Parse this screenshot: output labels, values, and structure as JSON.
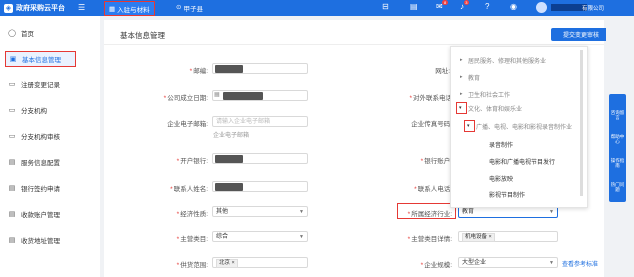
{
  "topbar": {
    "app_name": "政府采购云平台",
    "menu_icon": "hamburger-icon",
    "settle_label": "入驻与材料",
    "location_label": "甲子县",
    "badge_messages": "8",
    "badge_notice": "3",
    "user_suffix": "有限公司"
  },
  "sidebar": {
    "items": [
      {
        "label": "首页",
        "icon": "home-icon"
      },
      {
        "label": "基本信息管理",
        "icon": "info-card-icon"
      },
      {
        "label": "注册变更记录",
        "icon": "record-icon"
      },
      {
        "label": "分支机构",
        "icon": "branch-icon"
      },
      {
        "label": "分支机构审核",
        "icon": "audit-icon"
      },
      {
        "label": "服务信息配置",
        "icon": "service-icon"
      },
      {
        "label": "银行签约申请",
        "icon": "bank-icon"
      },
      {
        "label": "收款账户管理",
        "icon": "account-icon"
      },
      {
        "label": "收货地址管理",
        "icon": "address-icon"
      }
    ]
  },
  "main": {
    "title": "基本信息管理",
    "submit_label": "提交变更审核"
  },
  "form": {
    "postcode_label": "邮编:",
    "website_label": "网址:",
    "founded_label": "公司成立日期:",
    "external_phone_label": "对外联系电话",
    "email_label": "企业电子邮箱:",
    "email_placeholder": "请输入企业电子邮箱",
    "email_hint": "企业电子邮箱",
    "fax_label": "企业传真号码:",
    "bank_label": "开户银行:",
    "account_label": "银行账户:",
    "contact_name_label": "联系人姓名:",
    "contact_phone_label": "联系人电话:",
    "economic_type_label": "经济性质:",
    "economic_type_value": "其他",
    "industry_label": "所属经济行业:",
    "industry_value": "教育",
    "main_category_label": "主营类目:",
    "main_category_value": "综合",
    "main_category_detail_label": "主营类目详情:",
    "main_category_detail_tag": "机电设备",
    "supply_scope_label": "供货范围:",
    "supply_scope_tag": "北京",
    "company_size_label": "企业规模:",
    "company_size_value": "大型企业",
    "reference_link": "查看参考标准"
  },
  "dropdown": {
    "items": [
      "居民服务、修理和其他服务业",
      "教育",
      "卫生和社会工作",
      "文化、体育和娱乐业",
      "广播、电视、电影和影视录音制作业",
      "录音制作",
      "电影和广播电视节目发行",
      "电影放映",
      "影视节目制作"
    ]
  },
  "right_panel": {
    "items": [
      "咨询留言",
      "帮助中心",
      "操作指南",
      "热门问题"
    ]
  }
}
